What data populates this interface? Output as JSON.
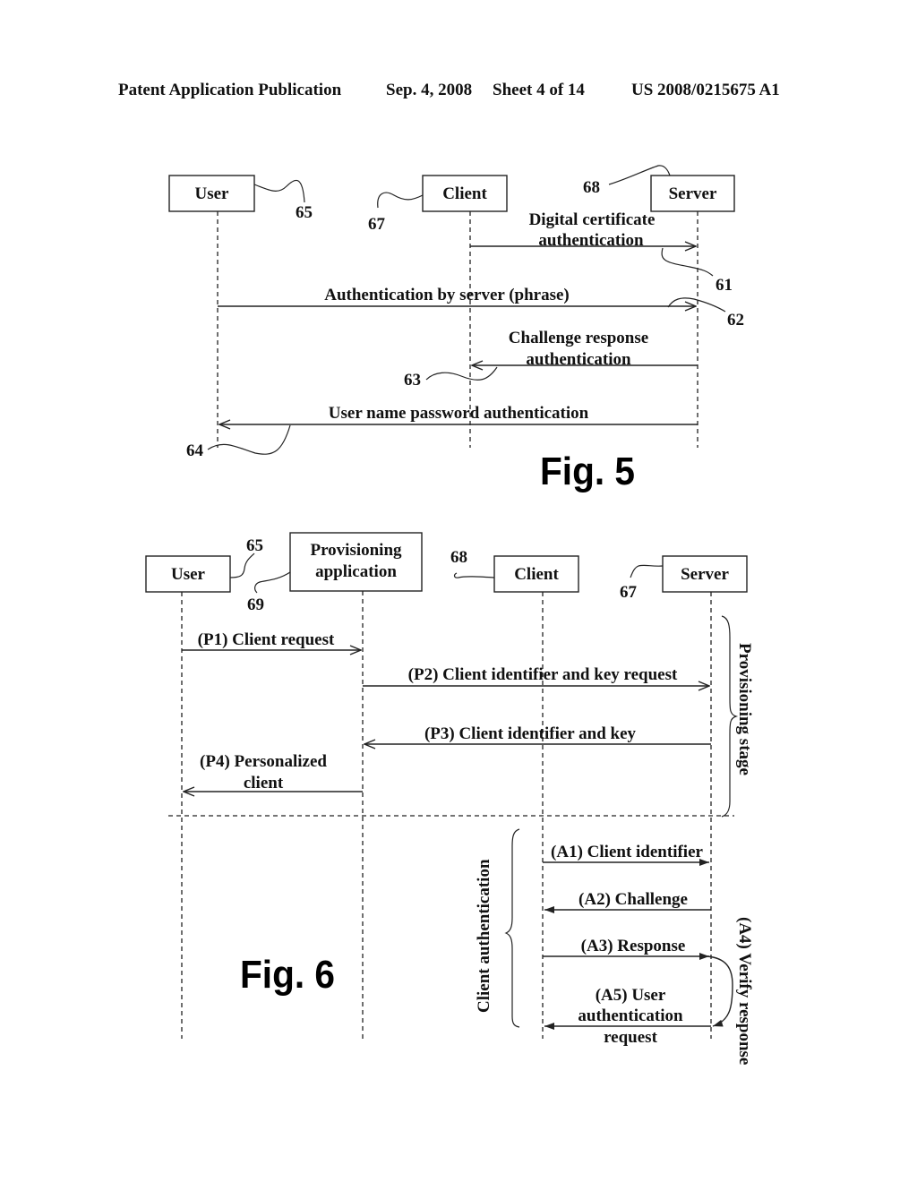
{
  "header": {
    "publication": "Patent Application Publication",
    "date": "Sep. 4, 2008",
    "sheet": "Sheet 4 of 14",
    "number": "US 2008/0215675 A1"
  },
  "fig5": {
    "title": "Fig. 5",
    "actors": [
      {
        "label": "User",
        "ref": "65"
      },
      {
        "label": "Client",
        "ref": "67"
      },
      {
        "label": "Server",
        "ref": "68"
      }
    ],
    "messages": [
      {
        "line1": "Digital certificate",
        "line2": "authentication",
        "from": "Client",
        "to": "Server",
        "ref": "61"
      },
      {
        "line1": "Authentication by server (phrase)",
        "from": "User",
        "to": "Server",
        "ref": "62"
      },
      {
        "line1": "Challenge response",
        "line2": "authentication",
        "from": "Server",
        "to": "Client",
        "ref": "63"
      },
      {
        "line1": "User name password authentication",
        "from": "Server",
        "to": "User",
        "ref": "64"
      }
    ]
  },
  "fig6": {
    "title": "Fig. 6",
    "actors": [
      {
        "label": "User",
        "ref": "65"
      },
      {
        "label_line1": "Provisioning",
        "label_line2": "application",
        "ref": "69"
      },
      {
        "label": "Client",
        "ref": "68"
      },
      {
        "label": "Server",
        "ref": "67"
      }
    ],
    "provisioning_stage_label": "Provisioning stage",
    "client_auth_label": "Client authentication",
    "verify_label": "(A4) Verify response",
    "messages": [
      {
        "line1": "(P1) Client request"
      },
      {
        "line1": "(P2) Client identifier and key request"
      },
      {
        "line1": "(P3) Client identifier and key"
      },
      {
        "line1": "(P4) Personalized",
        "line2": "client"
      },
      {
        "line1": "(A1) Client identifier"
      },
      {
        "line1": "(A2) Challenge"
      },
      {
        "line1": "(A3) Response"
      },
      {
        "line1": "(A5) User",
        "line2": "authentication",
        "line3": "request"
      }
    ]
  }
}
